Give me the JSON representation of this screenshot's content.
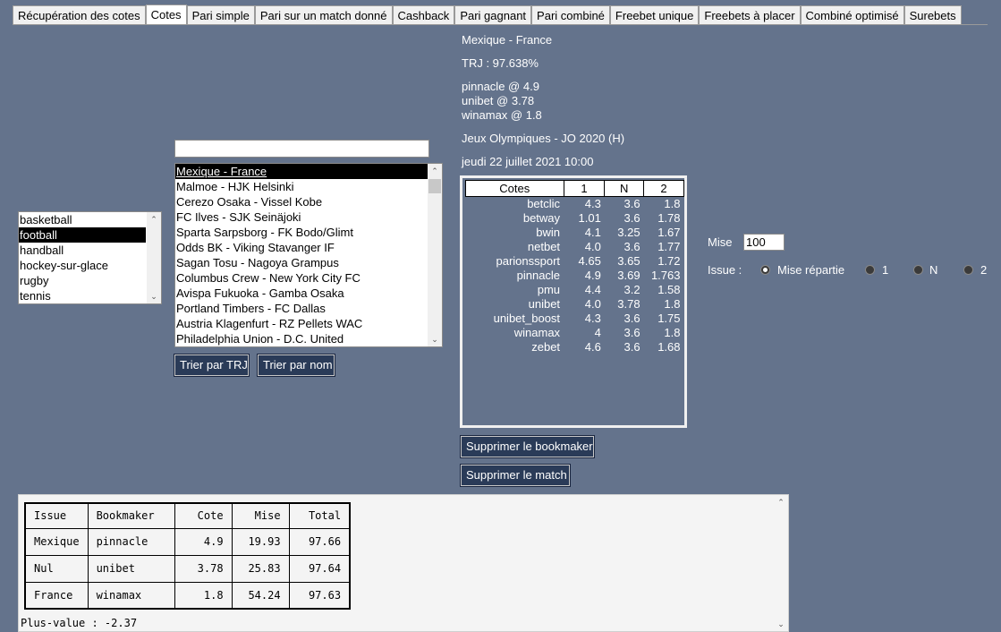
{
  "tabs": [
    "Récupération des cotes",
    "Cotes",
    "Pari simple",
    "Pari sur un match donné",
    "Cashback",
    "Pari gagnant",
    "Pari combiné",
    "Freebet unique",
    "Freebets à placer",
    "Combiné optimisé",
    "Surebets"
  ],
  "active_tab": "Cotes",
  "match_info": {
    "title": "Mexique - France",
    "trj": "TRJ : 97.638%",
    "best_odds": [
      "pinnacle @ 4.9",
      "unibet @ 3.78",
      "winamax @ 1.8"
    ],
    "competition": "Jeux Olympiques - JO 2020 (H)",
    "date": "jeudi 22 juillet 2021 10:00"
  },
  "sports": [
    "basketball",
    "football",
    "handball",
    "hockey-sur-glace",
    "rugby",
    "tennis"
  ],
  "selected_sport": "football",
  "search": {
    "value": ""
  },
  "matches": [
    "Mexique - France",
    "Malmoe - HJK Helsinki",
    "Cerezo Osaka - Vissel Kobe",
    "FC Ilves - SJK Seinäjoki",
    "Sparta Sarpsborg - FK Bodo/Glimt",
    "Odds BK - Viking Stavanger IF",
    "Sagan Tosu - Nagoya Grampus",
    "Columbus Crew - New York City FC",
    "Avispa Fukuoka - Gamba Osaka",
    "Portland Timbers - FC Dallas",
    "Austria Klagenfurt - RZ Pellets WAC",
    "Philadelphia Union - D.C. United"
  ],
  "selected_match": "Mexique - France",
  "buttons": {
    "sort_trj": "Trier par TRJ",
    "sort_name": "Trier par nom",
    "delete_bookmaker": "Supprimer le bookmaker",
    "delete_match": "Supprimer le match"
  },
  "odds_table": {
    "headers": [
      "Cotes",
      "1",
      "N",
      "2"
    ],
    "rows": [
      [
        "betclic",
        "4.3",
        "3.6",
        "1.8"
      ],
      [
        "betway",
        "1.01",
        "3.6",
        "1.78"
      ],
      [
        "bwin",
        "4.1",
        "3.25",
        "1.67"
      ],
      [
        "netbet",
        "4.0",
        "3.6",
        "1.77"
      ],
      [
        "parionssport",
        "4.65",
        "3.65",
        "1.72"
      ],
      [
        "pinnacle",
        "4.9",
        "3.69",
        "1.763"
      ],
      [
        "pmu",
        "4.4",
        "3.2",
        "1.58"
      ],
      [
        "unibet",
        "4.0",
        "3.78",
        "1.8"
      ],
      [
        "unibet_boost",
        "4.3",
        "3.6",
        "1.75"
      ],
      [
        "winamax",
        "4",
        "3.6",
        "1.8"
      ],
      [
        "zebet",
        "4.6",
        "3.6",
        "1.68"
      ]
    ]
  },
  "stake": {
    "label": "Mise",
    "value": "100",
    "issue_label": "Issue :",
    "options": [
      "Mise répartie",
      "1",
      "N",
      "2"
    ],
    "selected": "Mise répartie"
  },
  "result": {
    "headers": [
      "Issue",
      "Bookmaker",
      "Cote",
      "Mise",
      "Total"
    ],
    "rows": [
      [
        "Mexique",
        "pinnacle",
        "4.9",
        "19.93",
        "97.66"
      ],
      [
        "Nul",
        "unibet",
        "3.78",
        "25.83",
        "97.64"
      ],
      [
        "France",
        "winamax",
        "1.8",
        "54.24",
        "97.63"
      ]
    ],
    "plus_value": "Plus-value : -2.37"
  }
}
